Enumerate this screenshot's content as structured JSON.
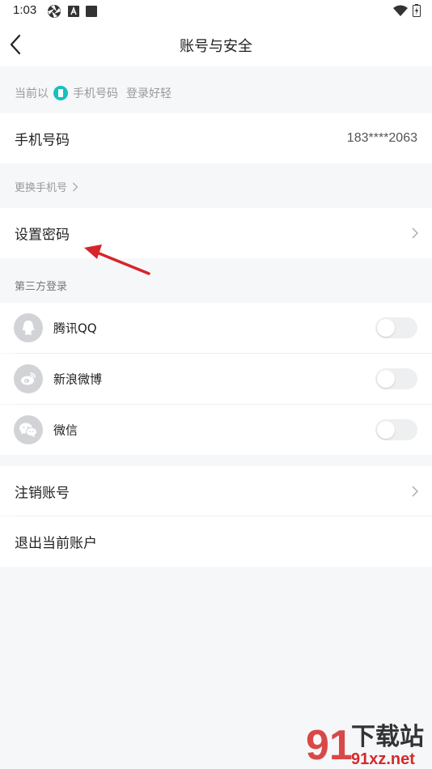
{
  "status_bar": {
    "time": "1:03"
  },
  "header": {
    "title": "账号与安全"
  },
  "login_info": {
    "prefix": "当前以",
    "method": "手机号码",
    "suffix": "登录好轻"
  },
  "phone": {
    "label": "手机号码",
    "value": "183****2063"
  },
  "change_phone": {
    "label": "更换手机号"
  },
  "set_password": {
    "label": "设置密码"
  },
  "third_party": {
    "title": "第三方登录",
    "items": [
      {
        "name": "腾讯QQ",
        "icon": "qq-icon",
        "enabled": false
      },
      {
        "name": "新浪微博",
        "icon": "weibo-icon",
        "enabled": false
      },
      {
        "name": "微信",
        "icon": "wechat-icon",
        "enabled": false
      }
    ]
  },
  "cancel_account": {
    "label": "注销账号"
  },
  "logout": {
    "label": "退出当前账户"
  },
  "watermark": {
    "brand": "下载站",
    "domain": "91xz.net",
    "mark": "91"
  },
  "colors": {
    "accent": "#14c1c0",
    "annotation_arrow": "#d9232a",
    "watermark_red": "#d42a2a",
    "background": "#f6f7f9"
  }
}
